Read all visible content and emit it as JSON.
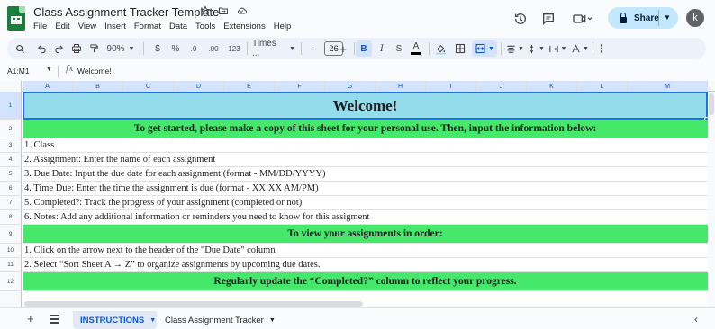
{
  "app": {
    "doc_title": "Class Assignment Tracker Template",
    "menu": [
      "File",
      "Edit",
      "View",
      "Insert",
      "Format",
      "Data",
      "Tools",
      "Extensions",
      "Help"
    ],
    "share_label": "Share",
    "avatar_letter": "k"
  },
  "toolbar": {
    "zoom": "90%",
    "currency": "$",
    "percent": "%",
    "dec_decrease": ".0",
    "dec_increase": ".00",
    "number_format": "123",
    "font_family": "Times ...",
    "font_size": "26",
    "minus": "−",
    "plus": "+",
    "bold": "B",
    "italic": "I",
    "strike": "S",
    "text_color": "A"
  },
  "formula_bar": {
    "name_box": "A1:M1",
    "fx": "fx",
    "content": "Welcome!"
  },
  "columns": [
    "A",
    "B",
    "C",
    "D",
    "E",
    "F",
    "G",
    "H",
    "I",
    "J",
    "K",
    "L",
    "M"
  ],
  "rows": [
    {
      "num": "1",
      "text": "Welcome!",
      "style": "welcome"
    },
    {
      "num": "2",
      "text": "To get started, please make a copy of this sheet for your personal use. Then, input the information below:",
      "style": "green"
    },
    {
      "num": "3",
      "text": "1. Class",
      "style": "plain"
    },
    {
      "num": "4",
      "text": "2. Assignment: Enter the name of each assignment",
      "style": "plain"
    },
    {
      "num": "5",
      "text": "3. Due Date: Input the due date for each assignment (format - MM/DD/YYYY)",
      "style": "plain"
    },
    {
      "num": "6",
      "text": "4. Time Due: Enter the time the assignment is due (format - XX:XX AM/PM)",
      "style": "plain"
    },
    {
      "num": "7",
      "text": "5. Completed?: Track the progress of your assignment (completed or not)",
      "style": "plain"
    },
    {
      "num": "8",
      "text": "6. Notes: Add any additional information or reminders you need to know for this assigment",
      "style": "plain"
    },
    {
      "num": "9",
      "text": "To view your assignments in order:",
      "style": "green"
    },
    {
      "num": "10",
      "text": "1. Click on the arrow next to the header of the \"Due Date\" column",
      "style": "plain"
    },
    {
      "num": "11",
      "text": "2. Select “Sort Sheet A → Z” to organize assignments by upcoming due dates.",
      "style": "plain"
    },
    {
      "num": "12",
      "text": "Regularly update the “Completed?” column to reflect your progress.",
      "style": "green"
    }
  ],
  "sheets": {
    "add": "+",
    "tabs": [
      {
        "label": "INSTRUCTIONS",
        "active": true
      },
      {
        "label": "Class Assignment Tracker",
        "active": false
      }
    ]
  },
  "colors": {
    "welcome_fill": "#93dcec",
    "green_fill": "#45e86b",
    "selection": "#1a73e8",
    "share_bg": "#c2e7ff"
  }
}
